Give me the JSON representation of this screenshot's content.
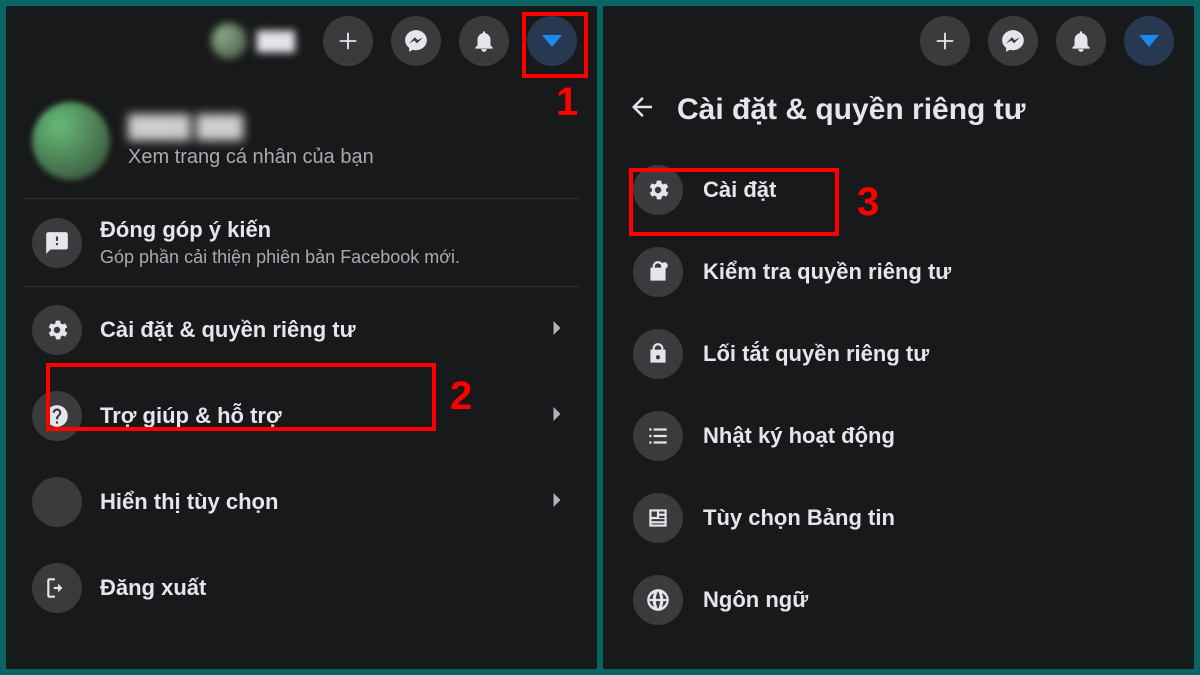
{
  "left": {
    "profile_subtitle": "Xem trang cá nhân của bạn",
    "feedback": {
      "title": "Đóng góp ý kiến",
      "subtitle": "Góp phần cải thiện phiên bản Facebook mới."
    },
    "items": [
      {
        "label": "Cài đặt & quyền riêng tư"
      },
      {
        "label": "Trợ giúp & hỗ trợ"
      },
      {
        "label": "Hiển thị tùy chọn"
      },
      {
        "label": "Đăng xuất"
      }
    ]
  },
  "right": {
    "title": "Cài đặt & quyền riêng tư",
    "items": [
      {
        "label": "Cài đặt"
      },
      {
        "label": "Kiểm tra quyền riêng tư"
      },
      {
        "label": "Lối tắt quyền riêng tư"
      },
      {
        "label": "Nhật ký hoạt động"
      },
      {
        "label": "Tùy chọn Bảng tin"
      },
      {
        "label": "Ngôn ngữ"
      }
    ]
  },
  "annotations": {
    "n1": "1",
    "n2": "2",
    "n3": "3"
  },
  "colors": {
    "highlight": "#ff0000",
    "accent_triangle": "#1d87f0",
    "bg_panel": "#18191a"
  }
}
